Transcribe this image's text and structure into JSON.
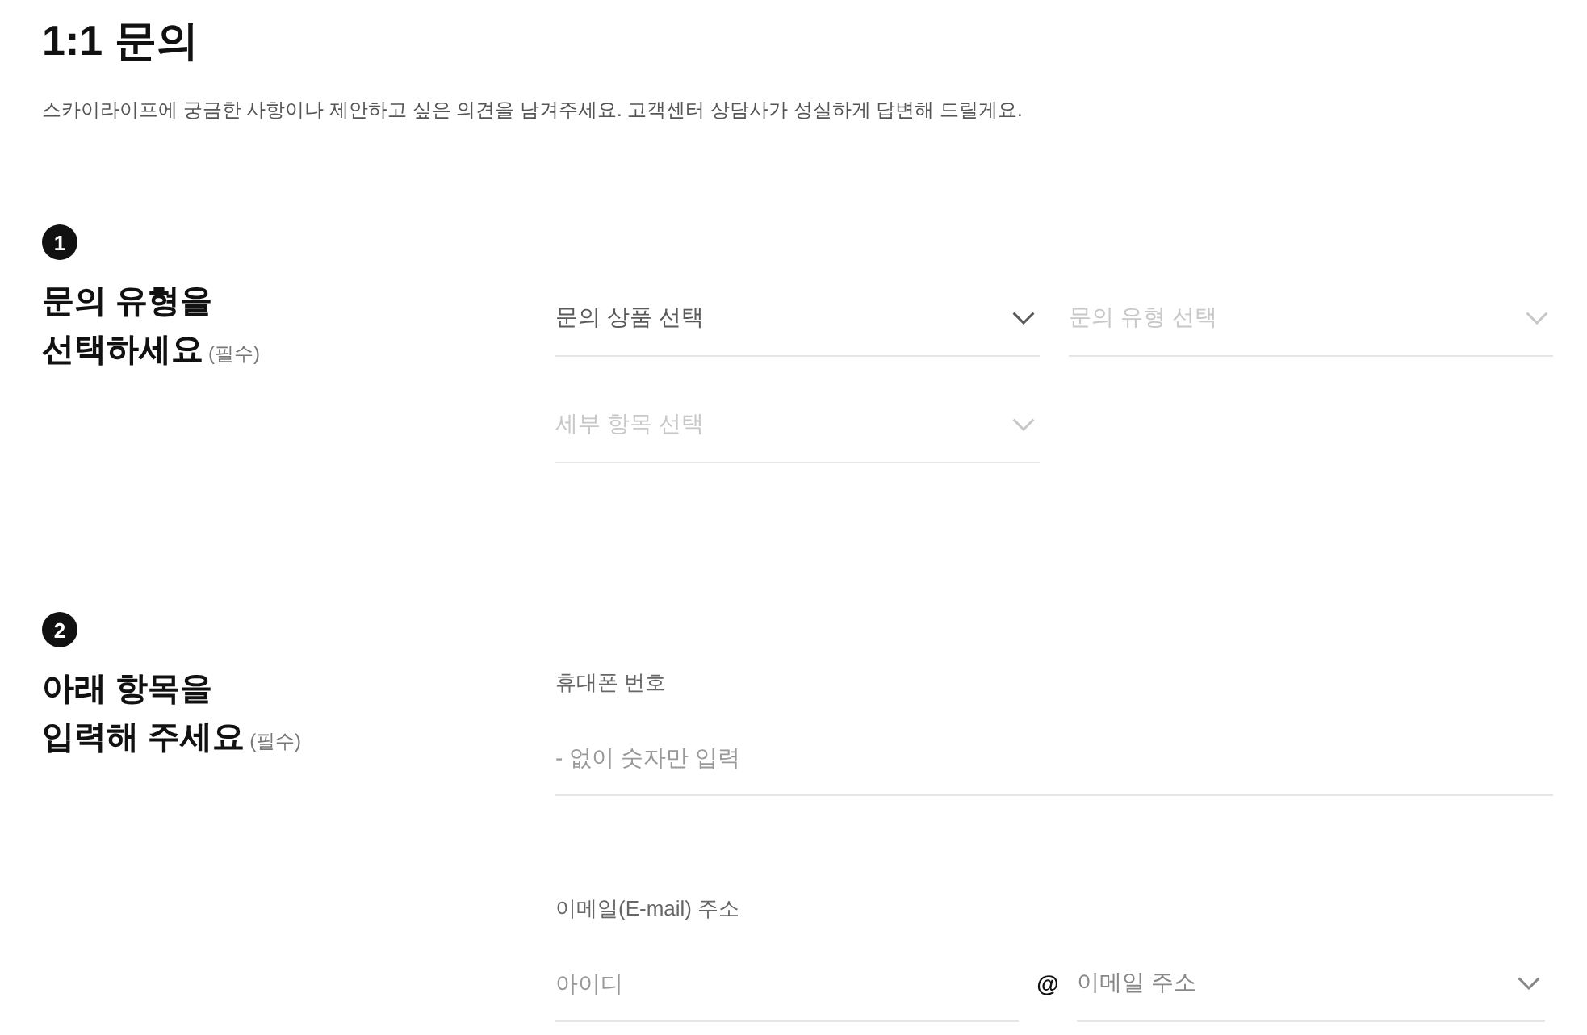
{
  "page": {
    "title": "1:1 문의",
    "description": "스카이라이프에 궁금한 사항이나 제안하고 싶은 의견을 남겨주세요. 고객센터 상담사가 성실하게 답변해 드릴게요."
  },
  "steps": [
    {
      "number": "1",
      "title_lines": [
        "문의 유형을",
        "선택하세요"
      ],
      "required": "(필수)",
      "fields": [
        {
          "kind": "select",
          "placeholder": "문의 상품 선택",
          "disabled": false
        },
        {
          "kind": "select",
          "placeholder": "문의 유형 선택",
          "disabled": true
        },
        {
          "kind": "select",
          "placeholder": "세부 항목 선택",
          "disabled": true
        }
      ]
    },
    {
      "number": "2",
      "title_lines": [
        "아래 항목을",
        "입력해 주세요"
      ],
      "required": "(필수)",
      "fields": [
        {
          "kind": "text",
          "label": "휴대폰 번호",
          "placeholder": "- 없이 숫자만 입력"
        },
        {
          "kind": "email",
          "label": "이메일(E-mail) 주소",
          "id_placeholder": "아이디",
          "separator": "@",
          "domain": {
            "placeholder": "이메일 주소",
            "disabled": false
          }
        }
      ]
    }
  ]
}
